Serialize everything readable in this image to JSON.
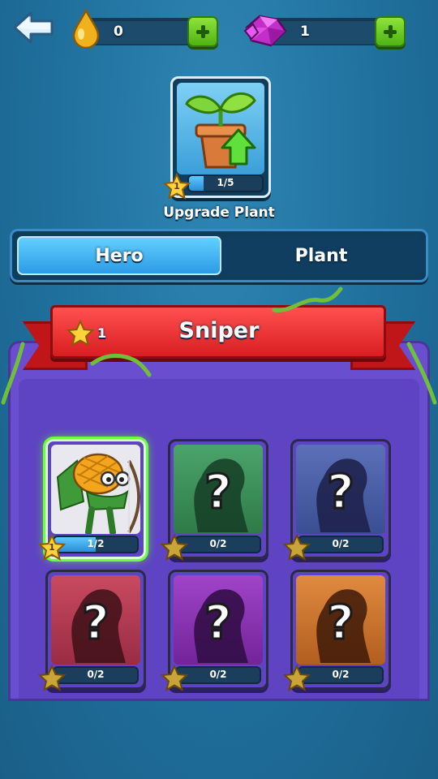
{
  "header": {
    "back_icon": "back-arrow-icon",
    "resources": [
      {
        "icon": "water-drop-icon",
        "value": "0"
      },
      {
        "icon": "gem-icon",
        "value": "1"
      }
    ]
  },
  "upgrade_plant": {
    "icon": "potted-sprout-upgrade-icon",
    "level": "1",
    "progress_text": "1/5",
    "progress": 0.2,
    "label": "Upgrade Plant"
  },
  "tabs": [
    {
      "label": "Hero",
      "active": true
    },
    {
      "label": "Plant",
      "active": false
    }
  ],
  "category": {
    "title": "Sniper",
    "star_count": "1"
  },
  "heroes": [
    {
      "name": "pineapple-archer",
      "unlocked": true,
      "selected": true,
      "level": "1",
      "progress_text": "1/2",
      "progress": 0.5,
      "color": "#e8e8ee"
    },
    {
      "name": "locked-hero",
      "unlocked": false,
      "level": "",
      "progress_text": "0/2",
      "progress": 0,
      "color": "#3f8f5a"
    },
    {
      "name": "locked-hero",
      "unlocked": false,
      "level": "",
      "progress_text": "0/2",
      "progress": 0,
      "color": "#4b5fa8"
    },
    {
      "name": "locked-hero",
      "unlocked": false,
      "level": "",
      "progress_text": "0/2",
      "progress": 0,
      "color": "#b23a52"
    },
    {
      "name": "locked-hero",
      "unlocked": false,
      "level": "",
      "progress_text": "0/2",
      "progress": 0,
      "color": "#8a2fb0"
    },
    {
      "name": "locked-hero",
      "unlocked": false,
      "level": "",
      "progress_text": "0/2",
      "progress": 0,
      "color": "#c9702c"
    }
  ]
}
